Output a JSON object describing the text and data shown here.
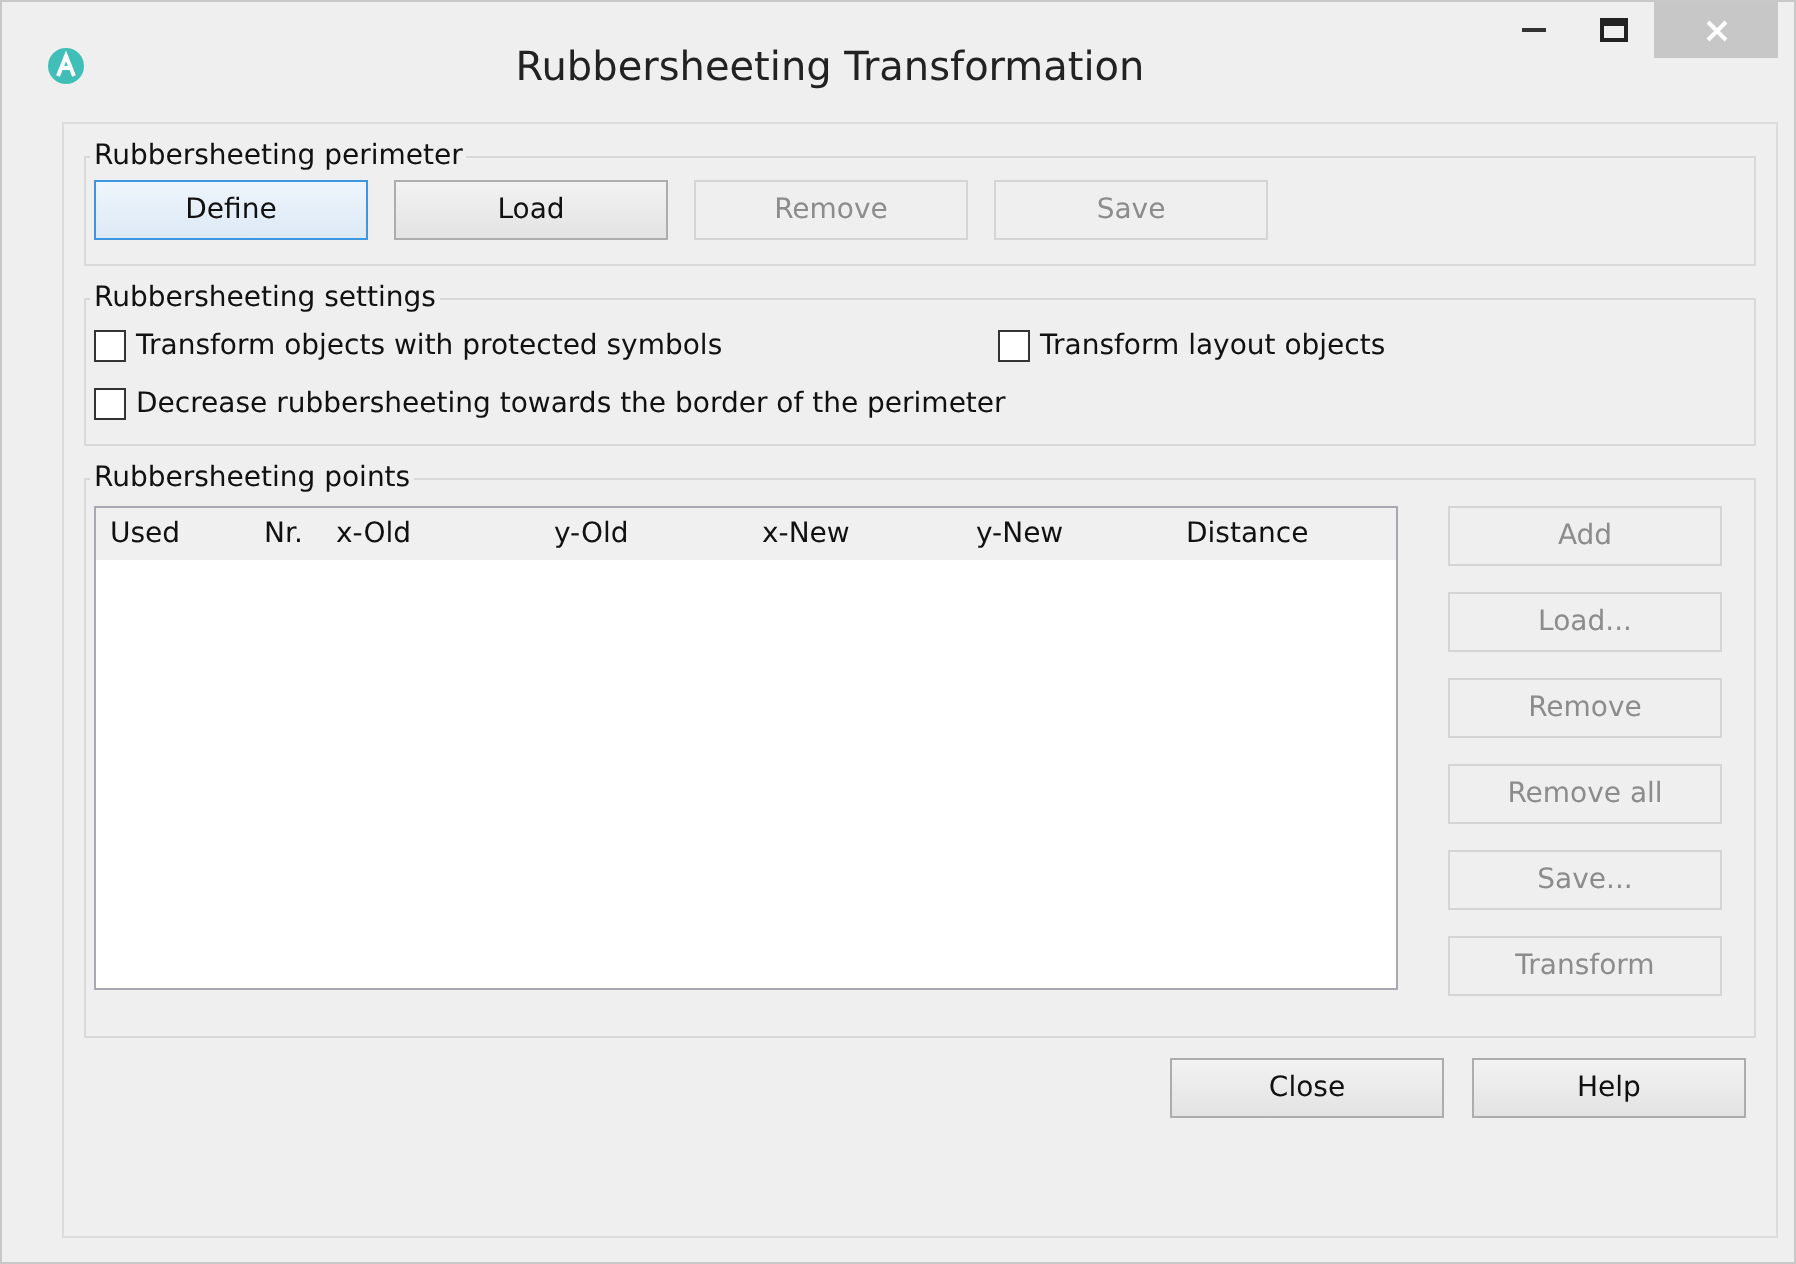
{
  "window": {
    "title": "Rubbersheeting Transformation"
  },
  "perimeter": {
    "title": "Rubbersheeting perimeter",
    "buttons": [
      {
        "label": "Define",
        "disabled": false,
        "focused": true
      },
      {
        "label": "Load",
        "disabled": false,
        "focused": false
      },
      {
        "label": "Remove",
        "disabled": true,
        "focused": false
      },
      {
        "label": "Save",
        "disabled": true,
        "focused": false
      }
    ]
  },
  "settings": {
    "title": "Rubbersheeting settings",
    "options": [
      {
        "label": "Transform objects with protected symbols",
        "checked": false
      },
      {
        "label": "Transform layout objects",
        "checked": false
      },
      {
        "label": "Decrease rubbersheeting towards the border of the perimeter",
        "checked": false
      }
    ]
  },
  "points": {
    "title": "Rubbersheeting points",
    "table": {
      "columns": [
        "Used",
        "Nr.",
        "x-Old",
        "y-Old",
        "x-New",
        "y-New",
        "Distance"
      ]
    },
    "buttons": [
      {
        "label": "Add",
        "disabled": true
      },
      {
        "label": "Load...",
        "disabled": true
      },
      {
        "label": "Remove",
        "disabled": true
      },
      {
        "label": "Remove all",
        "disabled": true
      },
      {
        "label": "Save...",
        "disabled": true
      },
      {
        "label": "Transform",
        "disabled": true
      }
    ]
  },
  "footer_buttons": [
    {
      "label": "Close",
      "disabled": false
    },
    {
      "label": "Help",
      "disabled": false
    }
  ]
}
